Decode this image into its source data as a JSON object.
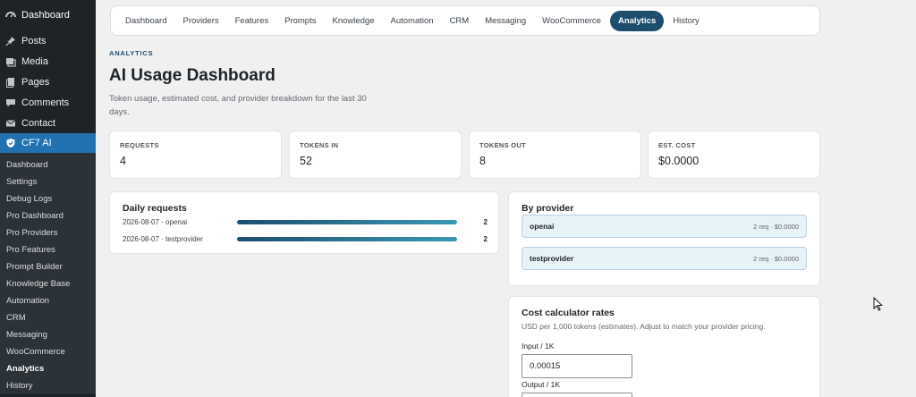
{
  "sidebar": {
    "top": {
      "label": "Dashboard",
      "icon": "dashboard-icon"
    },
    "items": [
      {
        "label": "Posts",
        "icon": "pin-icon"
      },
      {
        "label": "Media",
        "icon": "media-icon"
      },
      {
        "label": "Pages",
        "icon": "pages-icon"
      },
      {
        "label": "Comments",
        "icon": "comments-icon"
      },
      {
        "label": "Contact",
        "icon": "mail-icon"
      }
    ],
    "active": {
      "label": "CF7 AI",
      "icon": "shield-icon"
    },
    "submenu": [
      "Dashboard",
      "Settings",
      "Debug Logs",
      "Pro Dashboard",
      "Pro Providers",
      "Pro Features",
      "Prompt Builder",
      "Knowledge Base",
      "Automation",
      "CRM",
      "Messaging",
      "WooCommerce",
      "Analytics",
      "History"
    ],
    "submenu_current": "Analytics"
  },
  "tabs": [
    "Dashboard",
    "Providers",
    "Features",
    "Prompts",
    "Knowledge",
    "Automation",
    "CRM",
    "Messaging",
    "WooCommerce",
    "Analytics",
    "History"
  ],
  "active_tab": "Analytics",
  "page": {
    "eyebrow": "ANALYTICS",
    "title": "AI Usage Dashboard",
    "subtitle": "Token usage, estimated cost, and provider breakdown for the last 30 days."
  },
  "stats": [
    {
      "label": "REQUESTS",
      "value": "4"
    },
    {
      "label": "TOKENS IN",
      "value": "52"
    },
    {
      "label": "TOKENS OUT",
      "value": "8"
    },
    {
      "label": "EST. COST",
      "value": "$0.0000"
    }
  ],
  "daily": {
    "title": "Daily requests",
    "rows": [
      {
        "label": "2026-08-07 · openai",
        "count": "2",
        "fill": 1.0
      },
      {
        "label": "2026-08-07 · testprovider",
        "count": "2",
        "fill": 1.0
      }
    ]
  },
  "providers": {
    "title": "By provider",
    "rows": [
      {
        "name": "openai",
        "meta": "2 req · $0.0000"
      },
      {
        "name": "testprovider",
        "meta": "2 req · $0.0000"
      }
    ]
  },
  "calculator": {
    "title": "Cost calculator rates",
    "description": "USD per 1,000 tokens (estimates). Adjust to match your provider pricing.",
    "input_label": "Input / 1K",
    "input_value": "0.00015",
    "output_label": "Output / 1K",
    "output_value": ""
  },
  "colors": {
    "accent": "#1d4e6e",
    "wp_blue": "#2271b1",
    "sidebar_bg": "#1d2327"
  }
}
